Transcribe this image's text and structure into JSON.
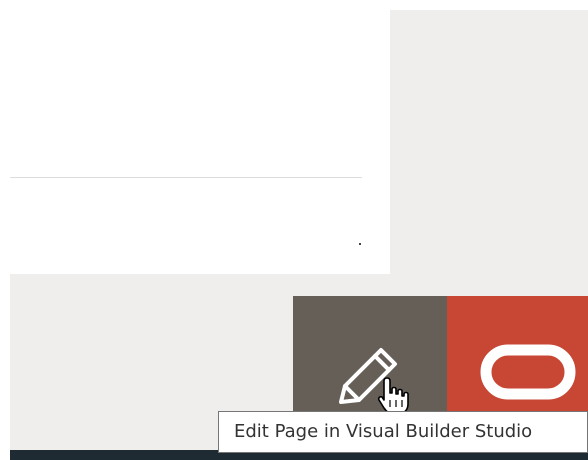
{
  "tooltip": {
    "text": "Edit Page in Visual Builder Studio"
  },
  "buttons": {
    "edit_page": {
      "icon": "pencil-icon"
    },
    "oracle": {
      "icon": "oracle-logo-icon"
    }
  },
  "colors": {
    "edit_button_bg": "#665f58",
    "oracle_button_bg": "#c74634",
    "panel_bg": "#efeeed",
    "bottom_bar": "#1e2b33"
  }
}
